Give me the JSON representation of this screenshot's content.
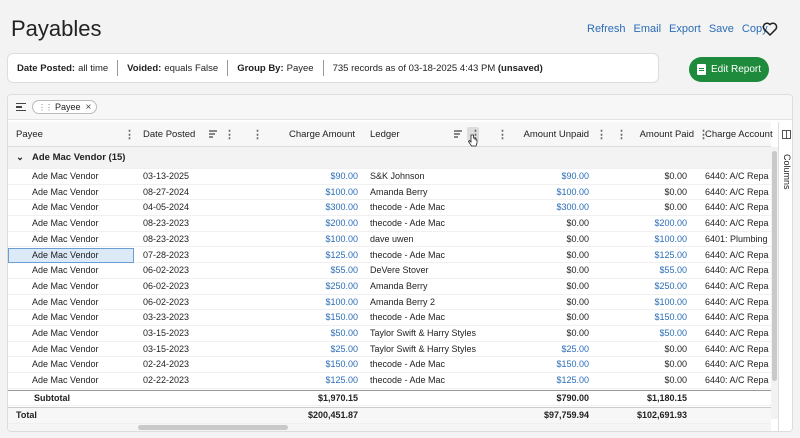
{
  "page": {
    "title": "Payables"
  },
  "actions": [
    "Refresh",
    "Email",
    "Export",
    "Save",
    "Copy"
  ],
  "filters": {
    "date_posted_label": "Date Posted:",
    "date_posted_value": "all time",
    "voided_label": "Voided:",
    "voided_value": "equals False",
    "group_by_label": "Group By:",
    "group_by_value": "Payee",
    "records_text": "735 records as of 03-18-2025 4:43 PM",
    "unsaved": "(unsaved)"
  },
  "edit_report": "Edit Report",
  "group_chip": "Payee",
  "columns": {
    "payee": "Payee",
    "date_posted": "Date Posted",
    "charge_amount": "Charge Amount",
    "ledger": "Ledger",
    "amount_unpaid": "Amount Unpaid",
    "amount_paid": "Amount Paid",
    "charge_account": "Charge Account"
  },
  "side_panel": "Columns",
  "group": {
    "label": "Ade Mac Vendor (15)"
  },
  "rows": [
    {
      "payee": "Ade Mac Vendor",
      "date": "03-13-2025",
      "charge": "$90.00",
      "ledger": "S&K Johnson",
      "unpaid": "$90.00",
      "paid": "$0.00",
      "account": "6440: A/C Repa"
    },
    {
      "payee": "Ade Mac Vendor",
      "date": "08-27-2024",
      "charge": "$100.00",
      "ledger": "Amanda Berry",
      "unpaid": "$100.00",
      "paid": "$0.00",
      "account": "6440: A/C Repa"
    },
    {
      "payee": "Ade Mac Vendor",
      "date": "04-05-2024",
      "charge": "$300.00",
      "ledger": "thecode - Ade Mac",
      "unpaid": "$300.00",
      "paid": "$0.00",
      "account": "6440: A/C Repa"
    },
    {
      "payee": "Ade Mac Vendor",
      "date": "08-23-2023",
      "charge": "$200.00",
      "ledger": "thecode - Ade Mac",
      "unpaid": "$0.00",
      "paid": "$200.00",
      "account": "6440: A/C Repa"
    },
    {
      "payee": "Ade Mac Vendor",
      "date": "08-23-2023",
      "charge": "$100.00",
      "ledger": "dave uwen",
      "unpaid": "$0.00",
      "paid": "$100.00",
      "account": "6401: Plumbing"
    },
    {
      "payee": "Ade Mac Vendor",
      "date": "07-28-2023",
      "charge": "$125.00",
      "ledger": "thecode - Ade Mac",
      "unpaid": "$0.00",
      "paid": "$125.00",
      "account": "6440: A/C Repa"
    },
    {
      "payee": "Ade Mac Vendor",
      "date": "06-02-2023",
      "charge": "$55.00",
      "ledger": "DeVere Stover",
      "unpaid": "$0.00",
      "paid": "$55.00",
      "account": "6440: A/C Repa"
    },
    {
      "payee": "Ade Mac Vendor",
      "date": "06-02-2023",
      "charge": "$250.00",
      "ledger": "Amanda Berry",
      "unpaid": "$0.00",
      "paid": "$250.00",
      "account": "6440: A/C Repa"
    },
    {
      "payee": "Ade Mac Vendor",
      "date": "06-02-2023",
      "charge": "$100.00",
      "ledger": "Amanda Berry 2",
      "unpaid": "$0.00",
      "paid": "$100.00",
      "account": "6440: A/C Repa"
    },
    {
      "payee": "Ade Mac Vendor",
      "date": "03-23-2023",
      "charge": "$150.00",
      "ledger": "thecode - Ade Mac",
      "unpaid": "$0.00",
      "paid": "$150.00",
      "account": "6440: A/C Repa"
    },
    {
      "payee": "Ade Mac Vendor",
      "date": "03-15-2023",
      "charge": "$50.00",
      "ledger": "Taylor Swift & Harry Styles",
      "unpaid": "$0.00",
      "paid": "$50.00",
      "account": "6440: A/C Repa"
    },
    {
      "payee": "Ade Mac Vendor",
      "date": "03-15-2023",
      "charge": "$25.00",
      "ledger": "Taylor Swift & Harry Styles",
      "unpaid": "$25.00",
      "paid": "$0.00",
      "account": "6440: A/C Repa"
    },
    {
      "payee": "Ade Mac Vendor",
      "date": "02-24-2023",
      "charge": "$150.00",
      "ledger": "thecode - Ade Mac",
      "unpaid": "$150.00",
      "paid": "$0.00",
      "account": "6440: A/C Repa"
    },
    {
      "payee": "Ade Mac Vendor",
      "date": "02-22-2023",
      "charge": "$125.00",
      "ledger": "thecode - Ade Mac",
      "unpaid": "$125.00",
      "paid": "$0.00",
      "account": "6440: A/C Repa"
    }
  ],
  "subtotal": {
    "label": "Subtotal",
    "charge": "$1,970.15",
    "unpaid": "$790.00",
    "paid": "$1,180.15"
  },
  "total": {
    "label": "Total",
    "charge": "$200,451.87",
    "unpaid": "$97,759.94",
    "paid": "$102,691.93"
  },
  "colors": {
    "link": "#2a6db6",
    "accent": "#1e8a3c"
  }
}
